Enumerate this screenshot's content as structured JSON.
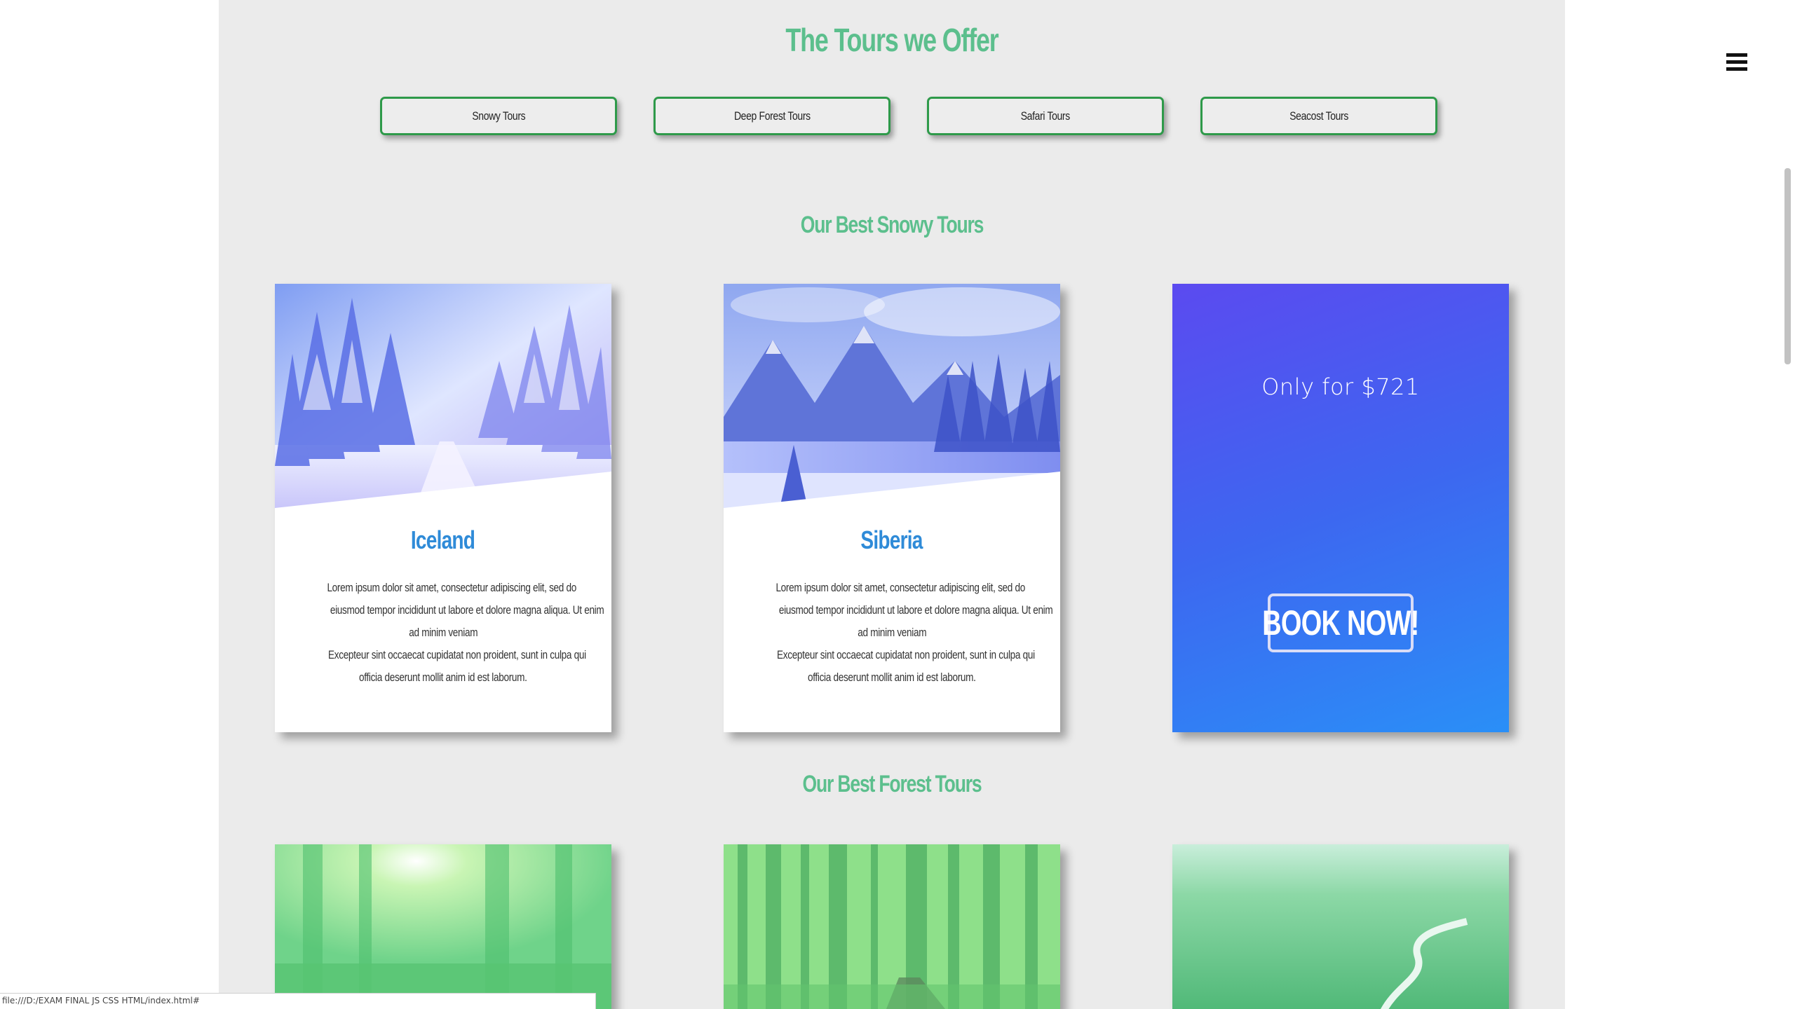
{
  "header": {
    "title": "The Tours we Offer",
    "menu_icon": "hamburger-menu-icon"
  },
  "tour_buttons": [
    {
      "label": "Snowy Tours"
    },
    {
      "label": "Deep Forest Tours"
    },
    {
      "label": "Safari Tours"
    },
    {
      "label": "Seacost Tours"
    }
  ],
  "snowy": {
    "title": "Our Best Snowy Tours",
    "cards": [
      {
        "title": "Iceland",
        "text_lines_1": [
          "Lorem ipsum dolor sit amet, consectetur adipiscing elit, sed do",
          "eiusmod tempor incididunt ut labore et dolore magna aliqua. Ut enim",
          "ad minim veniam"
        ],
        "text_lines_2": [
          "Excepteur sint occaecat cupidatat non proident, sunt in culpa qui",
          "officia deserunt mollit anim id est laborum."
        ]
      },
      {
        "title": "Siberia",
        "text_lines_1": [
          "Lorem ipsum dolor sit amet, consectetur adipiscing elit, sed do",
          "eiusmod tempor incididunt ut labore et dolore magna aliqua. Ut enim",
          "ad minim veniam"
        ],
        "text_lines_2": [
          "Excepteur sint occaecat cupidatat non proident, sunt in culpa qui",
          "officia deserunt mollit anim id est laborum."
        ]
      }
    ],
    "promo": {
      "price": "Only for $721",
      "book_label": "BOOK NOW!"
    }
  },
  "forest": {
    "title": "Our Best Forest Tours"
  },
  "status_bar": {
    "url": "file:///D:/EXAM FINAL JS CSS HTML/index.html#"
  },
  "colors": {
    "heading": "#5cbf8d",
    "card_title": "#2f8bd8",
    "button_border": "#2e9a4a",
    "promo_gradient_start": "#5b4af0",
    "promo_gradient_end": "#2a8ff7"
  }
}
